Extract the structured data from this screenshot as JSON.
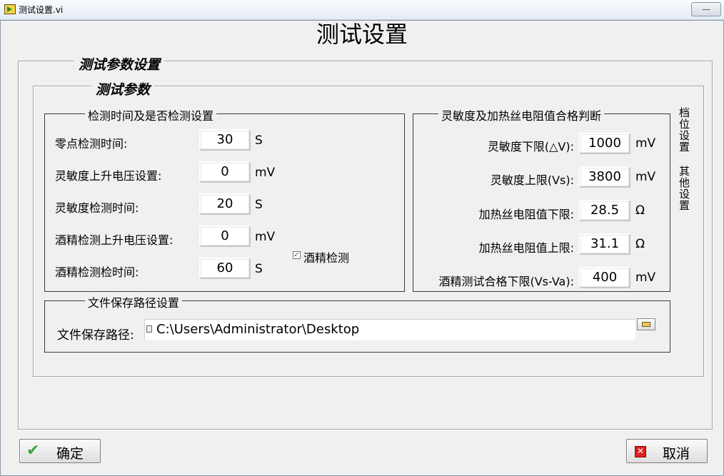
{
  "window": {
    "title": "测试设置.vi",
    "close_glyph": "—"
  },
  "page_title": "测试设置",
  "outer_group": {
    "legend": "测试参数设置"
  },
  "inner_group": {
    "legend": "测试参数"
  },
  "detect_group": {
    "legend": "检测时间及是否检测设置",
    "rows": [
      {
        "label": "零点检测时间:",
        "value": "30",
        "unit": "S"
      },
      {
        "label": "灵敏度上升电压设置:",
        "value": "0",
        "unit": "mV"
      },
      {
        "label": "灵敏度检测时间:",
        "value": "20",
        "unit": "S"
      },
      {
        "label": "酒精检测上升电压设置:",
        "value": "0",
        "unit": "mV"
      },
      {
        "label": "酒精检测检时间:",
        "value": "60",
        "unit": "S"
      }
    ],
    "alcohol_check": {
      "label": "酒精检测",
      "checked": true,
      "mark": "✓"
    }
  },
  "judge_group": {
    "legend": "灵敏度及加热丝电阻值合格判断",
    "rows": [
      {
        "label": "灵敏度下限(△V):",
        "value": "1000",
        "unit": "mV"
      },
      {
        "label": "灵敏度上限(Vs):",
        "value": "3800",
        "unit": "mV"
      },
      {
        "label": "加热丝电阻值下限:",
        "value": "28.5",
        "unit": "Ω"
      },
      {
        "label": "加热丝电阻值上限:",
        "value": "31.1",
        "unit": "Ω"
      },
      {
        "label": "酒精测试合格下限(Vs-Va):",
        "value": "400",
        "unit": "mV"
      }
    ]
  },
  "side_tabs": [
    "档位设置",
    "其他设置"
  ],
  "file_group": {
    "legend": "文件保存路径设置",
    "label": "文件保存路径:",
    "path": "C:\\Users\\Administrator\\Desktop"
  },
  "buttons": {
    "ok": "确定",
    "cancel": "取消",
    "ok_icon": "✔",
    "cancel_icon": "✕"
  },
  "colors": {
    "background": "#f0f0f0",
    "ok_icon": "#3aa83a",
    "cancel_icon": "#d22222"
  }
}
